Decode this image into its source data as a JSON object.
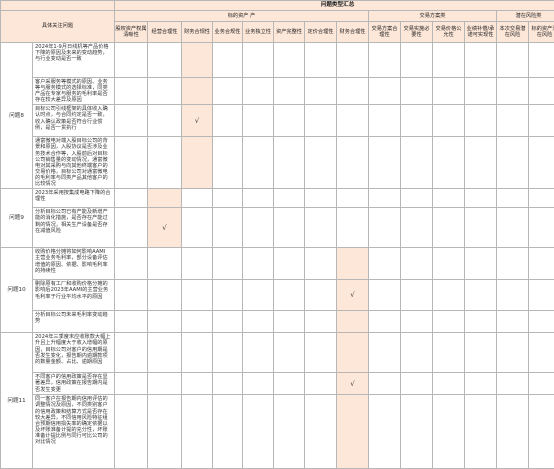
{
  "header": {
    "main_title": "问题类型汇总",
    "col_issue": "具体关注问题",
    "groups": [
      {
        "label": "标的资产 产"
      },
      {
        "label": "交易方案类"
      },
      {
        "label": "潜在风险类"
      }
    ],
    "columns": [
      "股权资产权属清晰性",
      "经营合理性",
      "财务合规性",
      "业务合规性",
      "业务独立性",
      "资产完整性",
      "定价合理性",
      "财务合理性",
      "交易方案合理性",
      "交易实施必要性",
      "交易价格公允性",
      "业绩补偿/承诺可实现性",
      "本次交易潜在风险",
      "标的资产潜在风险"
    ]
  },
  "mark_symbol": "√",
  "rows": [
    {
      "label": "问题8",
      "items": [
        "2024年1-9月日线机等产品价格下降的原因及未来的变动趋势，与行业变动是否一致",
        "客户采服务等模式的原因、业务等与服务模式的选择标准，同类产品在专家与服务的毛利率是否存在较大差异及原因",
        "目标公司引线框架的具体收入确认时点，与合同约定是否一致，收入确认政策是否符合行业惯例，是否一贯执行",
        "通富微电对端入股目标公司的背景和原因，入股协议是否涉及业务技术合作等，入股前后对目标公司销售量的变动情况，通富微电对其采购与向其他终端客户的交易价格，目标公司对通富微电的毛利率与同类产品其他客户的比较情况"
      ],
      "marked_column": 2
    },
    {
      "label": "问题9",
      "items": [
        "2023年采用按集成电路下降的合理性",
        "分析目标公司已有产能及新增产能的消化措施，是否存在产能过剩的情况，相关生产设备是否存在减值风险"
      ],
      "marked_column": 1
    },
    {
      "label": "问题10",
      "items": [
        "收购价格分摊将如何影响AAMI 主营业务毛利率，部分设备评估增值的原因、依据、影响毛利率的持续性",
        "剔除原有工厂和收购价格分摊的影响后2023年AAMI的主营业务毛利率于行业平均水平的原因",
        "分析目标公司未来毛利率变动趋势"
      ],
      "marked_column": 7
    },
    {
      "label": "问题11",
      "items": [
        "2024年三季度末应收账款大幅上升且上升幅度大于收入增幅的原因，目标公司对客户的信用期是否发生变化，报告期内逾期款项的数量金额、占比、逾期原因",
        "不同客户的信用政策是否存在显著差异，信用政策在报告期内是否发生变更",
        "同一客户在报告期内信用评估的调整情况及原因，不同类别客户的信用政策和结算方式是否存在较大差异，不同信用风险特征组合预期信用损失率的确定依据以及坏账准备计提的充分性，坏账准备计提比例与同行可比公司的对比情况"
      ],
      "marked_column": 7
    }
  ]
}
